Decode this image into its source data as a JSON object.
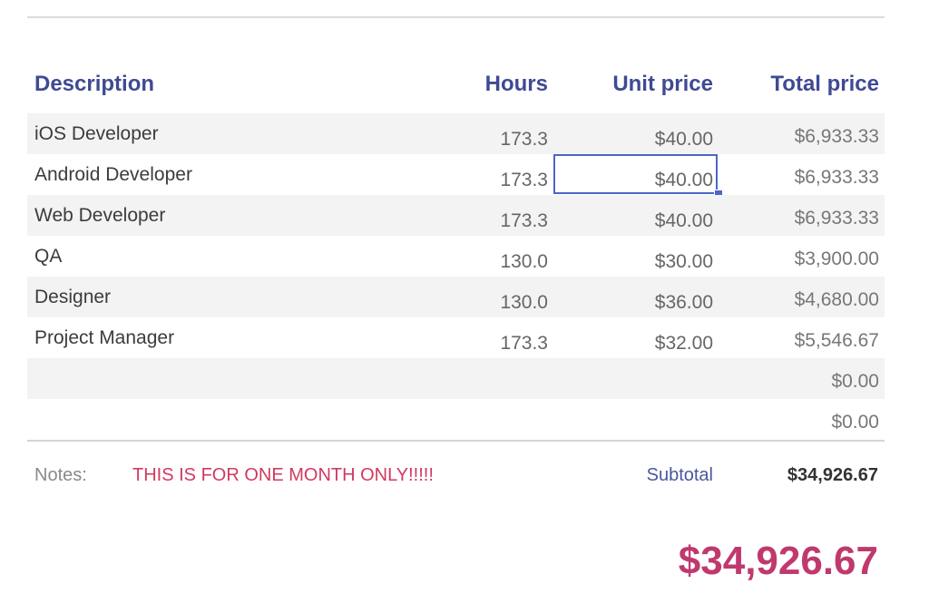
{
  "table": {
    "headers": {
      "description": "Description",
      "hours": "Hours",
      "unit_price": "Unit price",
      "total_price": "Total price"
    },
    "rows": [
      {
        "description": "iOS Developer",
        "hours": "173.3",
        "unit_price": "$40.00",
        "total_price": "$6,933.33"
      },
      {
        "description": "Android Developer",
        "hours": "173.3",
        "unit_price": "$40.00",
        "total_price": "$6,933.33"
      },
      {
        "description": "Web Developer",
        "hours": "173.3",
        "unit_price": "$40.00",
        "total_price": "$6,933.33"
      },
      {
        "description": "QA",
        "hours": "130.0",
        "unit_price": "$30.00",
        "total_price": "$3,900.00"
      },
      {
        "description": "Designer",
        "hours": "130.0",
        "unit_price": "$36.00",
        "total_price": "$4,680.00"
      },
      {
        "description": "Project Manager",
        "hours": "173.3",
        "unit_price": "$32.00",
        "total_price": "$5,546.67"
      },
      {
        "description": "",
        "hours": "",
        "unit_price": "",
        "total_price": "$0.00"
      },
      {
        "description": "",
        "hours": "",
        "unit_price": "",
        "total_price": "$0.00"
      }
    ],
    "selected_cell": {
      "row": 1,
      "column": "unit_price"
    }
  },
  "footer": {
    "notes_label": "Notes:",
    "notes_value": "THIS IS FOR ONE MONTH ONLY!!!!!",
    "subtotal_label": "Subtotal",
    "subtotal_value": "$34,926.67",
    "grand_total": "$34,926.67"
  },
  "colors": {
    "header_text": "#3f4a93",
    "notes_text": "#d2395f",
    "grand_total": "#c0396e",
    "selection": "#4a66c9"
  }
}
